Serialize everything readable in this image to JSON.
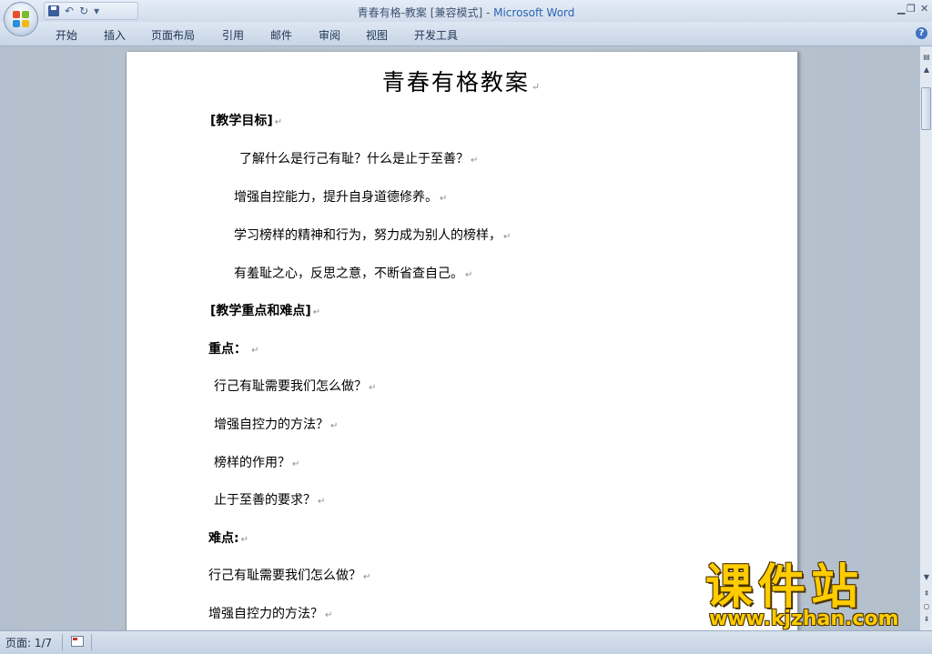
{
  "window": {
    "doc_name": "青春有格-教案",
    "mode": "[兼容模式]",
    "separator": " - ",
    "app_name": "Microsoft Word"
  },
  "ribbon": {
    "tabs": [
      "开始",
      "插入",
      "页面布局",
      "引用",
      "邮件",
      "审阅",
      "视图",
      "开发工具"
    ]
  },
  "document": {
    "title": "青春有格教案",
    "paragraphs": [
      {
        "text": "[教学目标]",
        "bold": true
      },
      {
        "text": "了解什么是行己有耻？什么是止于至善？",
        "bold": false
      },
      {
        "text": "增强自控能力，提升自身道德修养。",
        "bold": false
      },
      {
        "text": "学习榜样的精神和行为，努力成为别人的榜样，",
        "bold": false
      },
      {
        "text": "有羞耻之心，反思之意，不断省查自己。",
        "bold": false
      },
      {
        "text": "[教学重点和难点]",
        "bold": true
      },
      {
        "text": "重点：",
        "bold": true
      },
      {
        "text": "行己有耻需要我们怎么做？",
        "bold": false
      },
      {
        "text": "增强自控力的方法？",
        "bold": false
      },
      {
        "text": "榜样的作用？",
        "bold": false
      },
      {
        "text": "止于至善的要求？",
        "bold": false
      },
      {
        "text": "难点:",
        "bold": true
      },
      {
        "text": "行己有耻需要我们怎么做？",
        "bold": false
      },
      {
        "text": "增强自控力的方法？",
        "bold": false
      }
    ]
  },
  "statusbar": {
    "page_info": "页面: 1/7"
  },
  "watermark": {
    "brand": "课件站",
    "url": "www.kjzhan.com"
  }
}
